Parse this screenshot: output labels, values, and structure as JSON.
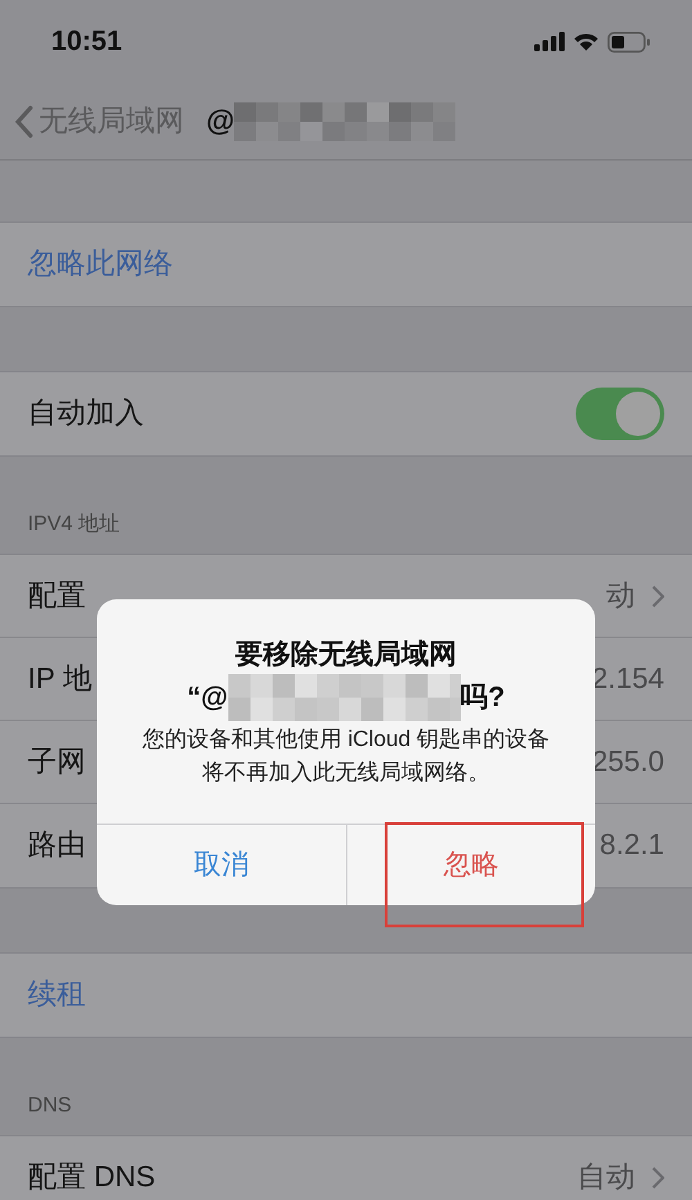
{
  "status_bar": {
    "time": "10:51"
  },
  "nav": {
    "back_label": "无线局域网",
    "title": "@",
    "title_redacted": true
  },
  "sections": [
    {
      "kind": "action",
      "rows": [
        {
          "label": "忽略此网络"
        }
      ]
    },
    {
      "kind": "toggle",
      "rows": [
        {
          "label": "自动加入",
          "on": true
        }
      ]
    },
    {
      "kind": "values",
      "header": "IPV4 地址",
      "rows": [
        {
          "label": "配置",
          "value": "动",
          "chevron": true
        },
        {
          "label": "IP 地",
          "value": "2.154",
          "chevron": false
        },
        {
          "label": "子网",
          "value": "255.0",
          "chevron": false
        },
        {
          "label": "路由",
          "value": "8.2.1",
          "chevron": false
        }
      ]
    },
    {
      "kind": "action",
      "rows": [
        {
          "label": "续租"
        }
      ]
    },
    {
      "kind": "values",
      "header": "DNS",
      "rows": [
        {
          "label": "配置 DNS",
          "value": "自动",
          "chevron": true
        }
      ]
    }
  ],
  "alert": {
    "title": "要移除无线局域网",
    "name_start": "“@",
    "name_redacted": true,
    "name_end": "吗?",
    "message": "您的设备和其他使用 iCloud 钥匙串的设备将不再加入此无线局域网络。",
    "buttons": [
      {
        "label": "取消",
        "kind": "cancel",
        "highlighted": false
      },
      {
        "label": "忽略",
        "kind": "destructive",
        "highlighted": true
      }
    ]
  }
}
